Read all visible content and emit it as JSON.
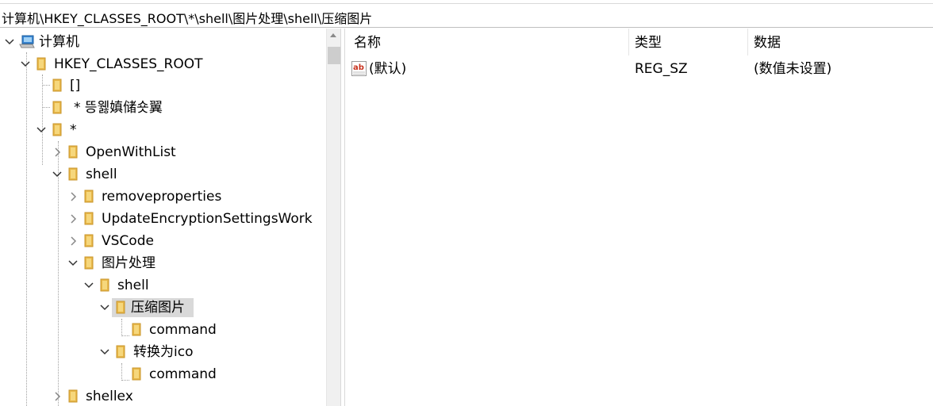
{
  "address": {
    "path": "计算机\\HKEY_CLASSES_ROOT\\*\\shell\\图片处理\\shell\\压缩图片"
  },
  "tree": {
    "items": [
      {
        "label": "计算机",
        "expanded": true
      },
      {
        "label": "HKEY_CLASSES_ROOT",
        "expanded": true
      },
      {
        "label": "[]"
      },
      {
        "label": "* 뜽웷嫃储숏翼"
      },
      {
        "label": "*",
        "expanded": true
      },
      {
        "label": "OpenWithList",
        "expanded": false
      },
      {
        "label": "shell",
        "expanded": true
      },
      {
        "label": "removeproperties",
        "expanded": false
      },
      {
        "label": "UpdateEncryptionSettingsWork",
        "expanded": false
      },
      {
        "label": "VSCode",
        "expanded": false
      },
      {
        "label": "图片处理",
        "expanded": true
      },
      {
        "label": "shell",
        "expanded": true
      },
      {
        "label": "压缩图片",
        "expanded": true,
        "selected": true
      },
      {
        "label": "command"
      },
      {
        "label": "转换为ico",
        "expanded": true
      },
      {
        "label": "command"
      },
      {
        "label": "shellex",
        "expanded": false
      }
    ]
  },
  "list": {
    "columns": {
      "name": "名称",
      "type": "类型",
      "data": "数据"
    },
    "rows": [
      {
        "name": "(默认)",
        "type": "REG_SZ",
        "data": "(数值未设置)",
        "icon": "string-value-icon"
      }
    ]
  },
  "colors": {
    "folder": "#e8b84a",
    "selected_bg": "#d9d9d9",
    "computer": "#3a87d4"
  }
}
